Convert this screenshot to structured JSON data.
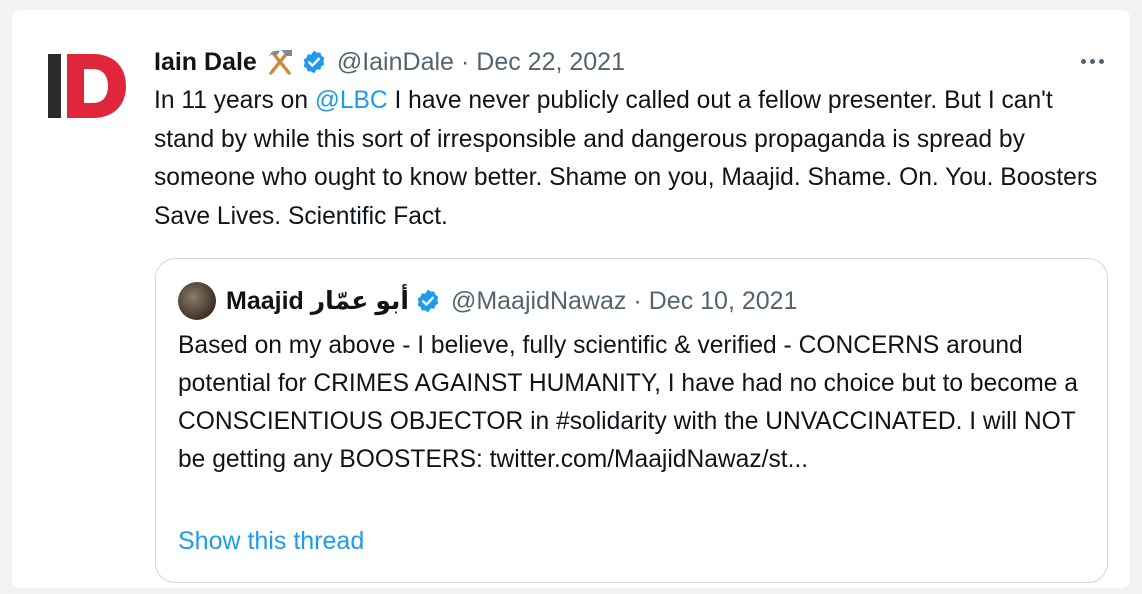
{
  "tweet": {
    "author_name": "Iain Dale",
    "author_emoji": "⚒️",
    "handle": "@IainDale",
    "separator": "·",
    "date": "Dec 22, 2021",
    "text_part1": "In 11 years on ",
    "mention": "@LBC",
    "text_part2": " I have never publicly called out a fellow presenter. But I can't stand by while this sort of irresponsible and dangerous propaganda is spread by someone who ought to know better. Shame on you, Maajid. Shame. On. You. Boosters Save Lives. Scientific Fact.",
    "avatar_icon": "id-logo-icon",
    "more_icon": "more-options-icon"
  },
  "quoted_tweet": {
    "author_name": "Maajid أبو عمّار",
    "handle": "@MaajidNawaz",
    "separator": "·",
    "date": "Dec 10, 2021",
    "text": "Based on my above - I believe, fully scientific & verified - CONCERNS around potential for CRIMES AGAINST HUMANITY, I have had no choice but to become a CONSCIENTIOUS OBJECTOR in #solidarity with the UNVACCINATED. I will NOT be getting any BOOSTERS: twitter.com/MaajidNawaz/st...",
    "show_thread_label": "Show this thread"
  },
  "colors": {
    "accent": "#1d9bf0",
    "muted": "#536471",
    "logo_red": "#e0263a",
    "logo_dark": "#2b2b2b"
  }
}
